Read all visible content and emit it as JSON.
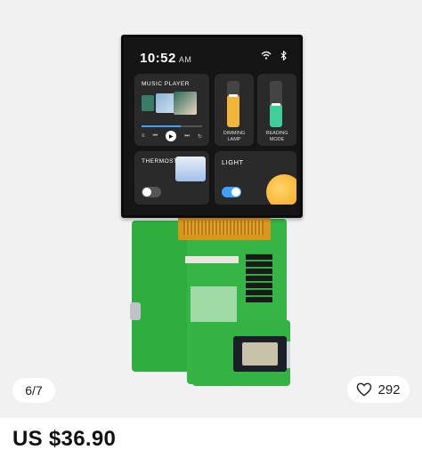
{
  "screen": {
    "time": "10:52",
    "ampm": "AM",
    "music_title": "MUSIC PLAYER",
    "progress": 0.65,
    "dimming": {
      "label_line1": "DIMMING",
      "label_line2": "LAMP",
      "level": 0.7,
      "color": "#f2b53a"
    },
    "reading": {
      "label_line1": "READING",
      "label_line2": "MODE",
      "level": 0.5,
      "color": "#3fcf9a"
    },
    "thermostat_title": "THERMOSTAT",
    "thermostat_on": false,
    "light_title": "LIGHT",
    "light_on": true,
    "accent": "#3fa0ff"
  },
  "gallery": {
    "page_indicator": "6/7",
    "like_count": "292"
  },
  "product": {
    "price": "US $36.90"
  }
}
